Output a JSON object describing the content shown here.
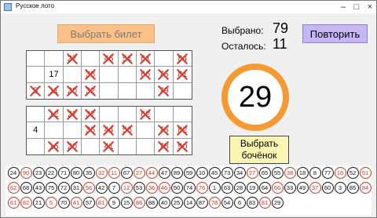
{
  "window": {
    "title": "Русское лото"
  },
  "buttons": {
    "choose_ticket": "Выбрать билет",
    "repeat": "Повторить",
    "choose_barrel_line1": "Выбрать",
    "choose_barrel_line2": "бочёнок"
  },
  "counters": {
    "selected_label": "Выбрано:",
    "selected_value": "79",
    "remaining_label": "Осталось:",
    "remaining_value": "11"
  },
  "current_barrel": "29",
  "tickets": [
    {
      "rows": [
        [
          {
            "n": ""
          },
          {
            "n": ""
          },
          {
            "n": "27",
            "x": true
          },
          {
            "n": ""
          },
          {
            "n": "46",
            "x": true
          },
          {
            "n": "51",
            "x": true
          },
          {
            "n": "61",
            "x": true
          },
          {
            "n": ""
          },
          {
            "n": "84",
            "x": true
          }
        ],
        [
          {
            "n": ""
          },
          {
            "n": "17"
          },
          {
            "n": ""
          },
          {
            "n": "38",
            "x": true
          },
          {
            "n": ""
          },
          {
            "n": ""
          },
          {
            "n": "66",
            "x": true
          },
          {
            "n": "76",
            "x": true
          },
          {
            "n": "81",
            "x": true
          }
        ],
        [
          {
            "n": "5",
            "x": true
          },
          {
            "n": "11",
            "x": true
          },
          {
            "n": "20",
            "x": true
          },
          {
            "n": "32",
            "x": true
          },
          {
            "n": ""
          },
          {
            "n": ""
          },
          {
            "n": ""
          },
          {
            "n": "79",
            "x": true
          },
          {
            "n": ""
          }
        ]
      ]
    },
    {
      "rows": [
        [
          {
            "n": ""
          },
          {
            "n": "12",
            "x": true
          },
          {
            "n": "27",
            "x": true
          },
          {
            "n": "37",
            "x": true
          },
          {
            "n": ""
          },
          {
            "n": ""
          },
          {
            "n": "62",
            "x": true
          },
          {
            "n": ""
          },
          {
            "n": ""
          }
        ],
        [
          {
            "n": "4"
          },
          {
            "n": ""
          },
          {
            "n": ""
          },
          {
            "n": "36",
            "x": true
          },
          {
            "n": "44",
            "x": true
          },
          {
            "n": "56",
            "x": true
          },
          {
            "n": ""
          },
          {
            "n": "76",
            "x": true
          },
          {
            "n": "82",
            "x": true
          }
        ],
        [
          {
            "n": ""
          },
          {
            "n": "16",
            "x": true
          },
          {
            "n": "20",
            "x": true
          },
          {
            "n": ""
          },
          {
            "n": "41",
            "x": true
          },
          {
            "n": ""
          },
          {
            "n": ""
          },
          {
            "n": "78",
            "x": true
          },
          {
            "n": "90",
            "x": true
          }
        ]
      ]
    }
  ],
  "drawn_barrels": [
    {
      "n": "24"
    },
    {
      "n": "90",
      "hit": true
    },
    {
      "n": "23"
    },
    {
      "n": "22"
    },
    {
      "n": "71"
    },
    {
      "n": "80"
    },
    {
      "n": "35"
    },
    {
      "n": "32",
      "hit": true
    },
    {
      "n": "11",
      "hit": true
    },
    {
      "n": "67"
    },
    {
      "n": "27",
      "hit": true
    },
    {
      "n": "44",
      "hit": true
    },
    {
      "n": "47"
    },
    {
      "n": "89"
    },
    {
      "n": "59"
    },
    {
      "n": "10"
    },
    {
      "n": "45"
    },
    {
      "n": "73"
    },
    {
      "n": "34"
    },
    {
      "n": "27",
      "hit": true
    },
    {
      "n": "65"
    },
    {
      "n": "55"
    },
    {
      "n": "38",
      "hit": true
    },
    {
      "n": "18"
    },
    {
      "n": "8"
    },
    {
      "n": "77"
    },
    {
      "n": "16",
      "hit": true
    },
    {
      "n": "52"
    },
    {
      "n": "51",
      "hit": true
    },
    {
      "n": "62",
      "hit": true
    },
    {
      "n": "68"
    },
    {
      "n": "43"
    },
    {
      "n": "75"
    },
    {
      "n": "72"
    },
    {
      "n": "31"
    },
    {
      "n": "56",
      "hit": true
    },
    {
      "n": "42"
    },
    {
      "n": "7"
    },
    {
      "n": "12",
      "hit": true
    },
    {
      "n": "53"
    },
    {
      "n": "36",
      "hit": true
    },
    {
      "n": "46",
      "hit": true
    },
    {
      "n": "50"
    },
    {
      "n": "74"
    },
    {
      "n": "76",
      "hit": true
    },
    {
      "n": "1"
    },
    {
      "n": "63"
    },
    {
      "n": "28"
    },
    {
      "n": "19"
    },
    {
      "n": "64"
    },
    {
      "n": "66",
      "hit": true
    },
    {
      "n": "33"
    },
    {
      "n": "49"
    },
    {
      "n": "37",
      "hit": true
    },
    {
      "n": "60"
    },
    {
      "n": "3"
    },
    {
      "n": "85"
    },
    {
      "n": "84",
      "hit": true
    },
    {
      "n": "61",
      "hit": true
    },
    {
      "n": "82",
      "hit": true
    },
    {
      "n": "21"
    },
    {
      "n": "5",
      "hit": true
    },
    {
      "n": "70"
    },
    {
      "n": "41",
      "hit": true
    },
    {
      "n": "57"
    },
    {
      "n": "81",
      "hit": true
    },
    {
      "n": "9"
    },
    {
      "n": "15"
    },
    {
      "n": "86",
      "hit": true
    },
    {
      "n": "88"
    },
    {
      "n": "40"
    },
    {
      "n": "25"
    },
    {
      "n": "14"
    },
    {
      "n": "87"
    },
    {
      "n": "78",
      "hit": true
    },
    {
      "n": "54"
    },
    {
      "n": "6"
    },
    {
      "n": "83"
    },
    {
      "n": "81",
      "hit": true
    },
    {
      "n": "29"
    }
  ]
}
